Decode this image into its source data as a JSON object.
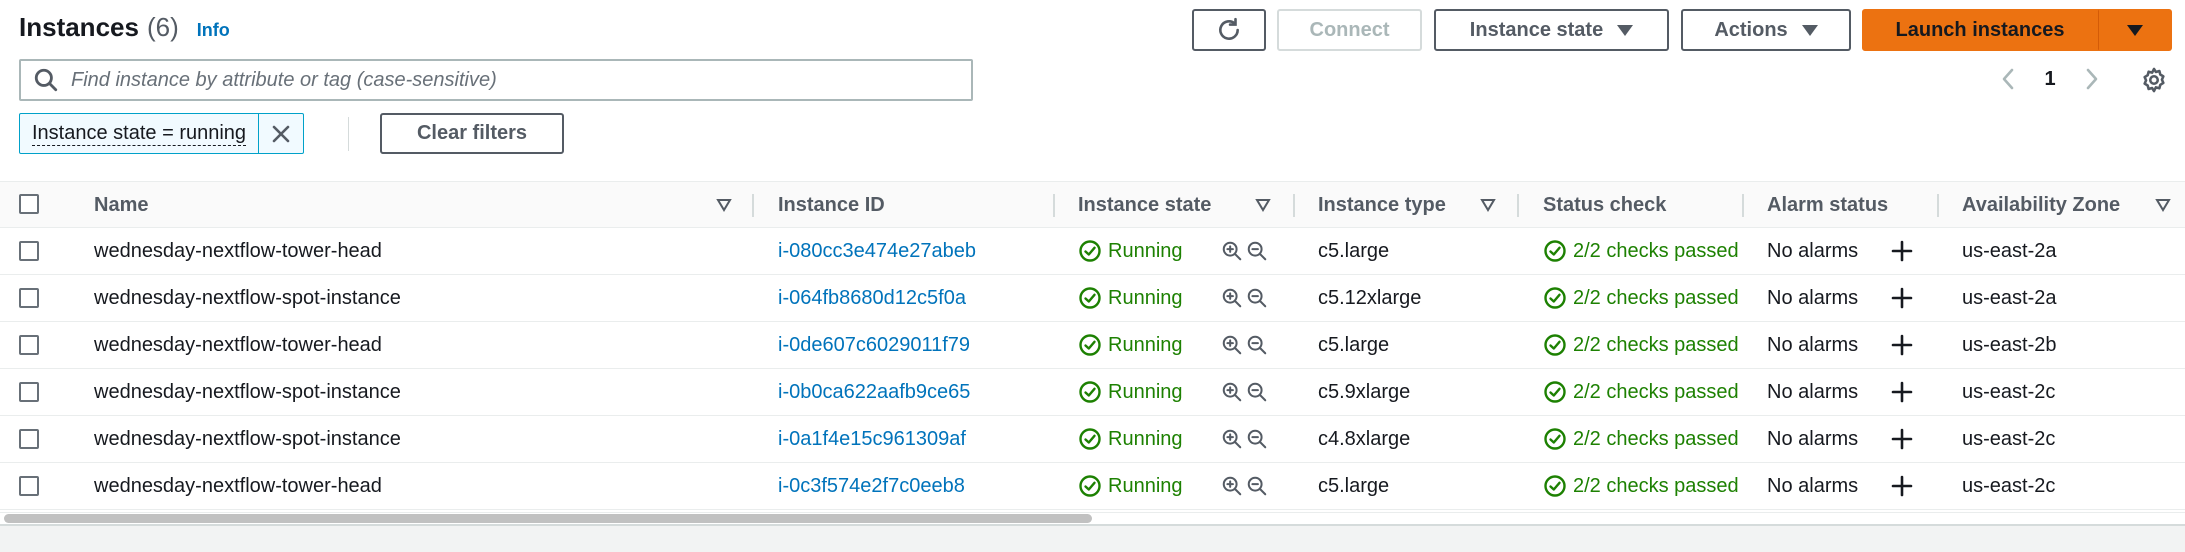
{
  "header": {
    "title": "Instances",
    "count": "(6)",
    "info_link": "Info"
  },
  "toolbar": {
    "connect_label": "Connect",
    "instance_state_label": "Instance state",
    "actions_label": "Actions",
    "launch_label": "Launch instances"
  },
  "search": {
    "placeholder": "Find instance by attribute or tag (case-sensitive)",
    "value": ""
  },
  "pagination": {
    "current_page": "1"
  },
  "filter": {
    "token_label": "Instance state = running",
    "clear_label": "Clear filters"
  },
  "table": {
    "columns": {
      "name": "Name",
      "instance_id": "Instance ID",
      "instance_state": "Instance state",
      "instance_type": "Instance type",
      "status_check": "Status check",
      "alarm_status": "Alarm status",
      "availability_zone": "Availability Zone"
    },
    "rows": [
      {
        "name": "wednesday-nextflow-tower-head",
        "instance_id": "i-080cc3e474e27abeb",
        "state": "Running",
        "type": "c5.large",
        "status": "2/2 checks passed",
        "alarm": "No alarms",
        "az": "us-east-2a"
      },
      {
        "name": "wednesday-nextflow-spot-instance",
        "instance_id": "i-064fb8680d12c5f0a",
        "state": "Running",
        "type": "c5.12xlarge",
        "status": "2/2 checks passed",
        "alarm": "No alarms",
        "az": "us-east-2a"
      },
      {
        "name": "wednesday-nextflow-tower-head",
        "instance_id": "i-0de607c6029011f79",
        "state": "Running",
        "type": "c5.large",
        "status": "2/2 checks passed",
        "alarm": "No alarms",
        "az": "us-east-2b"
      },
      {
        "name": "wednesday-nextflow-spot-instance",
        "instance_id": "i-0b0ca622aafb9ce65",
        "state": "Running",
        "type": "c5.9xlarge",
        "status": "2/2 checks passed",
        "alarm": "No alarms",
        "az": "us-east-2c"
      },
      {
        "name": "wednesday-nextflow-spot-instance",
        "instance_id": "i-0a1f4e15c961309af",
        "state": "Running",
        "type": "c4.8xlarge",
        "status": "2/2 checks passed",
        "alarm": "No alarms",
        "az": "us-east-2c"
      },
      {
        "name": "wednesday-nextflow-tower-head",
        "instance_id": "i-0c3f574e2f7c0eeb8",
        "state": "Running",
        "type": "c5.large",
        "status": "2/2 checks passed",
        "alarm": "No alarms",
        "az": "us-east-2c"
      }
    ]
  },
  "colors": {
    "primary_orange": "#ec7211",
    "link_blue": "#0073bb",
    "success_green": "#1d8102",
    "filter_token_border": "#00a1c9"
  },
  "icons": {
    "refresh": "refresh-icon",
    "caret": "caret-down-icon",
    "search": "search-icon",
    "prev": "chevron-left-icon",
    "next": "chevron-right-icon",
    "settings": "gear-icon",
    "dismiss": "close-icon",
    "sort": "sort-down-icon",
    "status_ok": "check-circle-icon",
    "zoom_in": "zoom-in-icon",
    "zoom_out": "zoom-out-icon",
    "add_alarm": "plus-icon"
  }
}
